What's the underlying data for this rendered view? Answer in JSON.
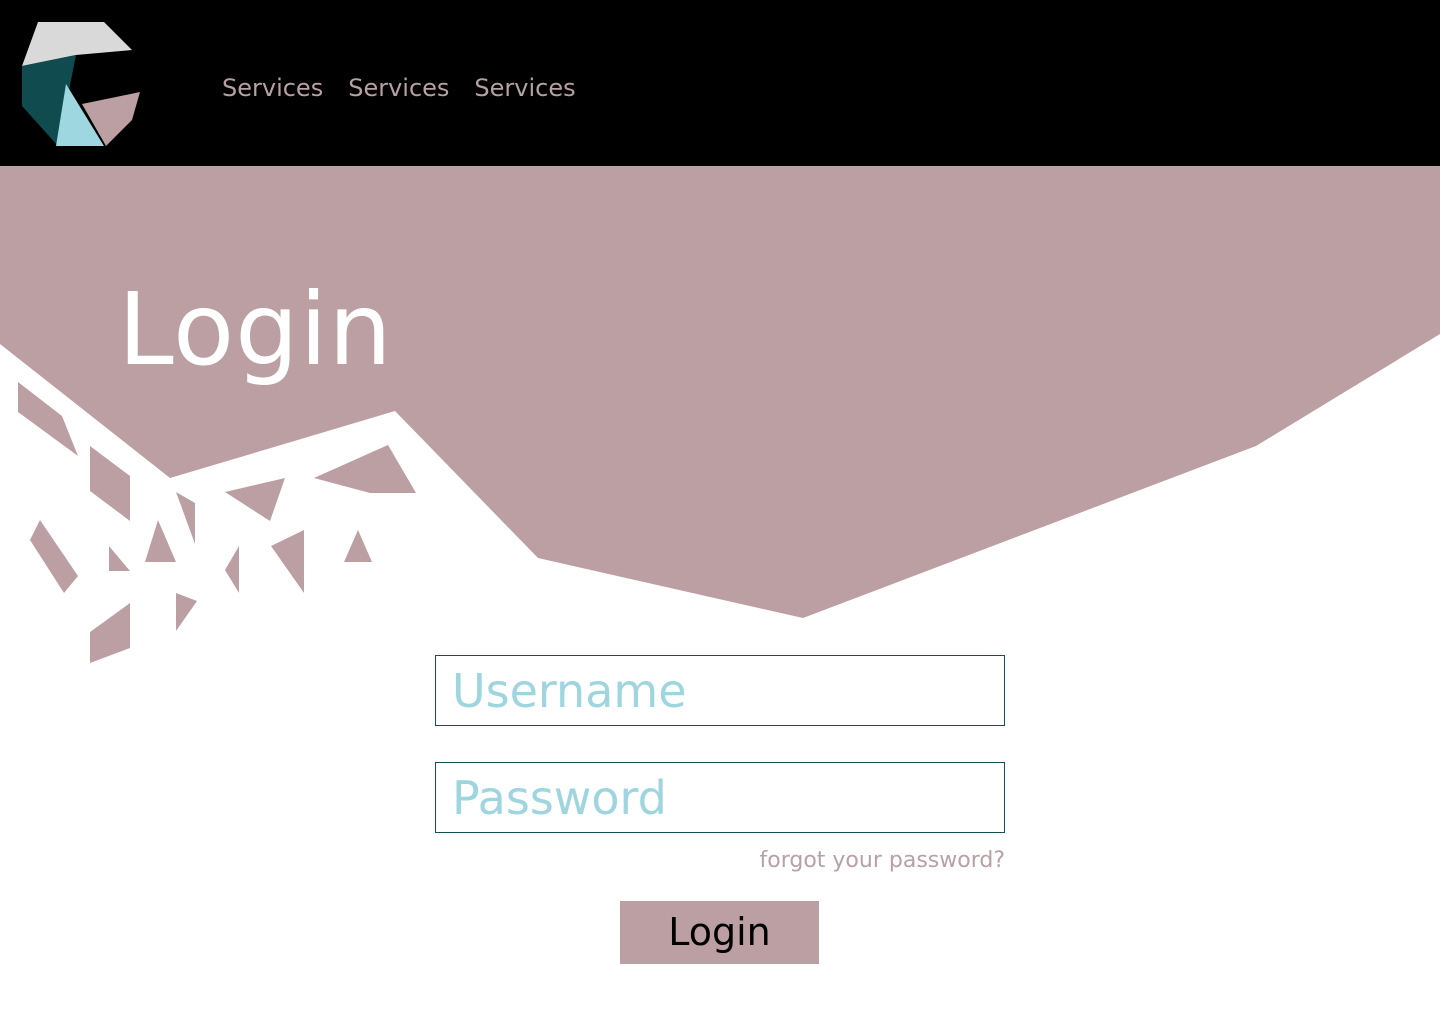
{
  "colors": {
    "header_background": "#000000",
    "accent_mauve": "#bc9fa3",
    "nav_text": "#b6a0a3",
    "input_border": "#174e55",
    "placeholder_text": "#9ed5df",
    "logo_light_gray": "#d9d9d9",
    "logo_dark_teal": "#0f4b4f",
    "logo_light_blue": "#9fd7e1",
    "logo_mauve": "#bc9fa3"
  },
  "header": {
    "logo_icon": "geometric-logo-icon",
    "nav_items": [
      "Services",
      "Services",
      "Services"
    ]
  },
  "hero": {
    "title": "Login"
  },
  "form": {
    "username_placeholder": "Username",
    "password_placeholder": "Password",
    "forgot_password_label": "forgot your password?",
    "submit_label": "Login"
  }
}
